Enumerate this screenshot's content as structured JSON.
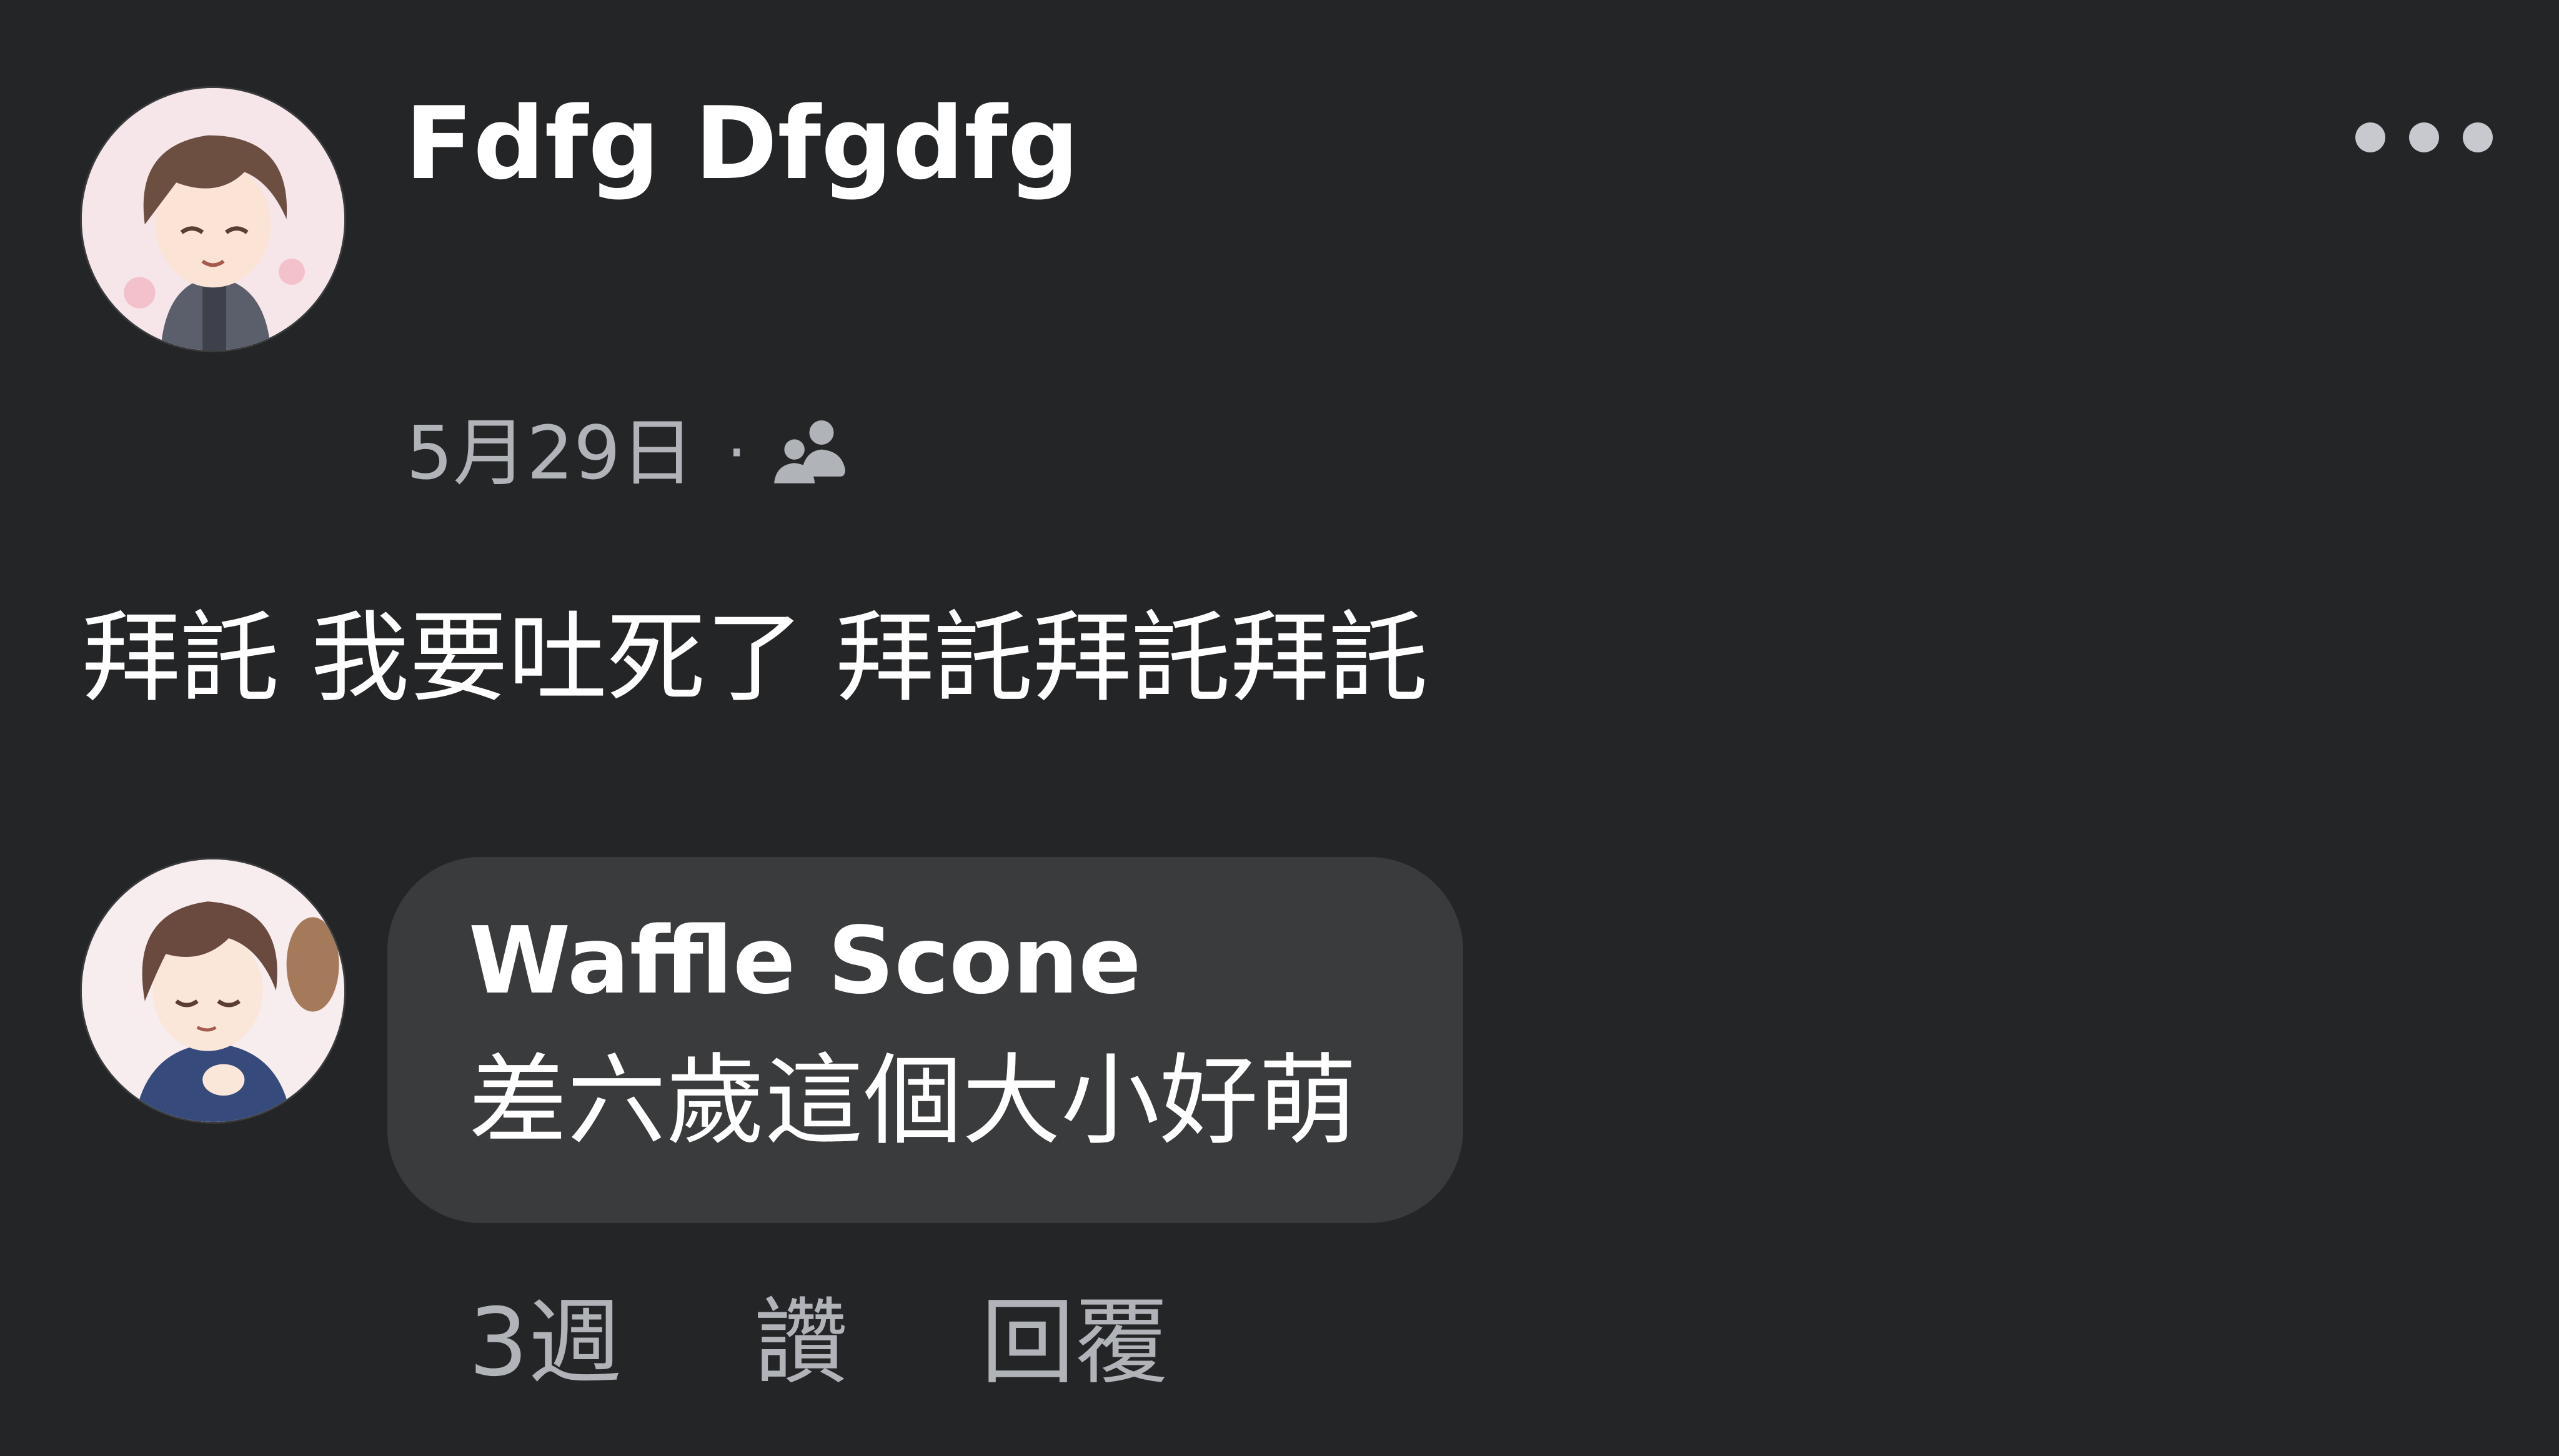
{
  "post": {
    "author_name": "Fdfg Dfgdfg",
    "date": "5月29日",
    "separator": "·",
    "audience_icon": "friends-icon",
    "text": "拜託 我要吐死了 拜託拜託拜託",
    "more_icon": "more-options-icon"
  },
  "comment": {
    "author_name": "Waffle Scone",
    "text": "差六歲這個大小好萌",
    "time_ago": "3週",
    "like_label": "讚",
    "reply_label": "回覆"
  },
  "colors": {
    "background": "#242527",
    "bubble": "#3a3b3c",
    "primary_text": "#ffffff",
    "secondary_text": "#b0b3b8"
  }
}
